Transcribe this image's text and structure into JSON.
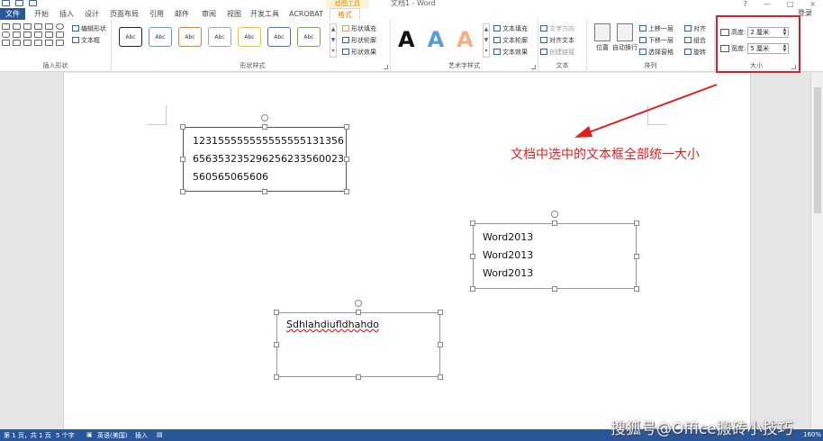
{
  "window": {
    "title": "文档1 - Word",
    "context_tool_header": "绘图工具",
    "login": "登录",
    "controls": [
      "?",
      "—",
      "□",
      "×"
    ]
  },
  "tabs": [
    "文件",
    "开始",
    "插入",
    "设计",
    "页面布局",
    "引用",
    "邮件",
    "审阅",
    "视图",
    "开发工具",
    "ACROBAT",
    "格式"
  ],
  "ribbon": {
    "insert_shapes": {
      "label": "插入形状",
      "edit_shape": "编辑形状",
      "text_box": "文本框"
    },
    "shape_styles": {
      "label": "形状样式",
      "swatch_text": "Abc",
      "swatch_colors": [
        "#222222",
        "#5b9bd5",
        "#ed7d31",
        "#a5a5a5",
        "#ffc000",
        "#4472c4",
        "#70ad47"
      ],
      "fill": "形状填充",
      "outline": "形状轮廓",
      "effects": "形状效果"
    },
    "wordart": {
      "label": "艺术字样式",
      "letters": [
        "A",
        "A",
        "A"
      ],
      "letter_colors": [
        "#111111",
        "#5b9bd5",
        "#f4b183"
      ],
      "text_fill": "文本填充",
      "text_outline": "文本轮廓",
      "text_effects": "文本效果"
    },
    "text": {
      "label": "文本",
      "direction": "文字方向",
      "align_text": "对齐文本",
      "create_link": "创建链接"
    },
    "arrange": {
      "label": "排列",
      "position": "位置",
      "wrap_text": "自动换行",
      "bring_forward": "上移一层",
      "send_backward": "下移一层",
      "selection_pane": "选择窗格",
      "align": "对齐",
      "group": "组合",
      "rotate": "旋转"
    },
    "size": {
      "label": "大小",
      "height_label": "高度:",
      "height_value": "2 厘米",
      "width_label": "宽度:",
      "width_value": "5 厘米"
    }
  },
  "document": {
    "textbox1_lines": [
      "123155555555555555131356",
      "656353235296256233560023",
      "560565065606"
    ],
    "textbox2_lines": [
      "Word2013",
      "Word2013",
      "Word2013"
    ],
    "textbox3_lines": [
      "Sdhlahdiufldhahdo"
    ],
    "annotation": "文档中选中的文本框全部统一大小"
  },
  "statusbar": {
    "page": "第 1 页，共 1 页",
    "words": "5 个字",
    "language": "英语(美国)",
    "mode": "插入",
    "zoom": "160%"
  },
  "watermark": "搜狐号@Office搬砖小技巧"
}
